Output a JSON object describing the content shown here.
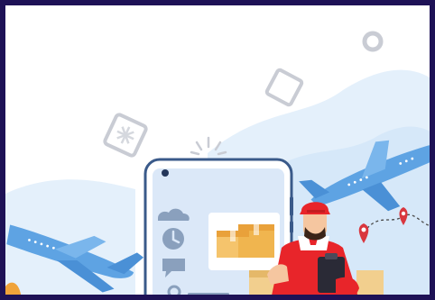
{
  "image": {
    "frame_color": "#1e1256",
    "background_color": "#ffffff",
    "sky_shape_color": "#e4f0fb",
    "plane_color": "#5ea3e3",
    "phone_screen_color": "#dbe8f8",
    "phone_frame_color": "#3a5a8a",
    "package_color": "#f5c46c",
    "courier_shirt_color": "#e8252a",
    "pin_color": "#d9363e",
    "icons": [
      "airplane-icon",
      "smartphone-icon",
      "package-icon",
      "clock-icon",
      "cloud-icon",
      "chat-icon",
      "map-pin-icon",
      "clipboard-icon"
    ]
  }
}
